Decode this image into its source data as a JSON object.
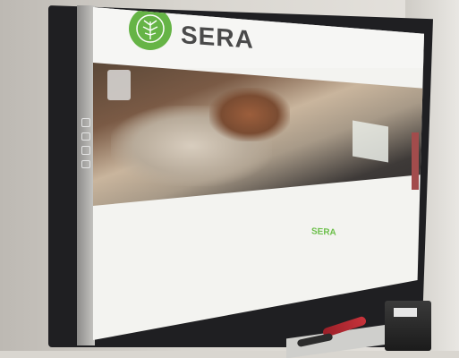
{
  "site": {
    "brand": "SERA",
    "tagline": "",
    "content_title": "SERA",
    "content_lines": [
      "",
      "",
      "",
      ""
    ]
  },
  "colors": {
    "brand_green": "#66b446",
    "text_dark": "#4a4a4a",
    "content_green": "#6cbf4a"
  },
  "icons": {
    "logo": "brain-tree-logo",
    "toolbar": [
      "cursor-icon",
      "pen-icon",
      "eraser-icon",
      "screen-icon"
    ]
  }
}
